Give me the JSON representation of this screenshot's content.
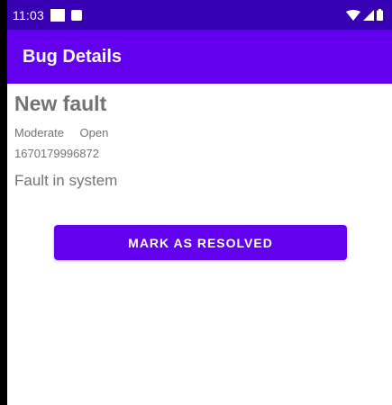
{
  "status_bar": {
    "time": "11:03",
    "icons": [
      "notification-square-icon",
      "notification-small-icon",
      "wifi-icon",
      "signal-icon",
      "battery-icon"
    ]
  },
  "app_bar": {
    "title": "Bug Details"
  },
  "bug": {
    "title": "New fault",
    "severity": "Moderate",
    "status": "Open",
    "id": "1670179996872",
    "description": "Fault in system"
  },
  "actions": {
    "resolve_label": "MARK AS RESOLVED"
  },
  "colors": {
    "status_bar": "#3700b3",
    "primary": "#6200ee",
    "text_secondary": "#737373"
  }
}
